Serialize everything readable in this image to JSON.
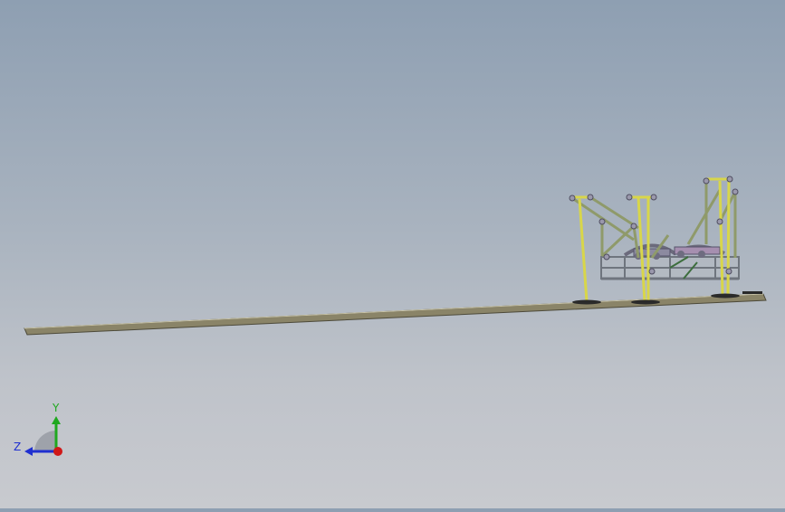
{
  "viewport": {
    "background_top": "#8e9fb2",
    "background_bottom": "#c8cacf"
  },
  "triad": {
    "y_label": "Y",
    "z_label": "Z",
    "y_color": "#1fa81f",
    "z_color": "#1f2fd0",
    "x_color": "#d01818"
  },
  "model": {
    "rail_color": "#8a8468",
    "leg_color": "#d8d64a",
    "brace_color": "#8f9a6a",
    "frame_color": "#9aa0a8",
    "joint_color": "#7c7a8c",
    "pad_color": "#2a2a2a"
  },
  "icons": [
    "coordinate-triad-icon"
  ]
}
